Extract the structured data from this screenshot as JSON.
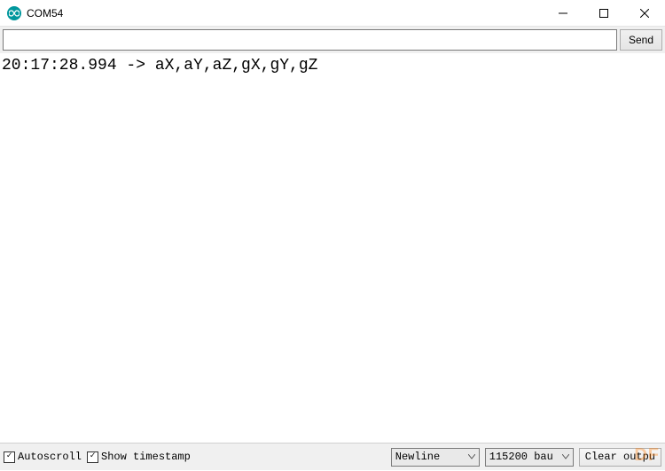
{
  "window": {
    "title": "COM54"
  },
  "toolbar": {
    "input_value": "",
    "send_label": "Send"
  },
  "console": {
    "line1": "20:17:28.994 -> aX,aY,aZ,gX,gY,gZ"
  },
  "bottombar": {
    "autoscroll_label": "Autoscroll",
    "autoscroll_checked": true,
    "timestamp_label": "Show timestamp",
    "timestamp_checked": true,
    "line_ending": "Newline",
    "baud": "115200 bau",
    "clear_label": "Clear outpu"
  },
  "watermark": "DF"
}
